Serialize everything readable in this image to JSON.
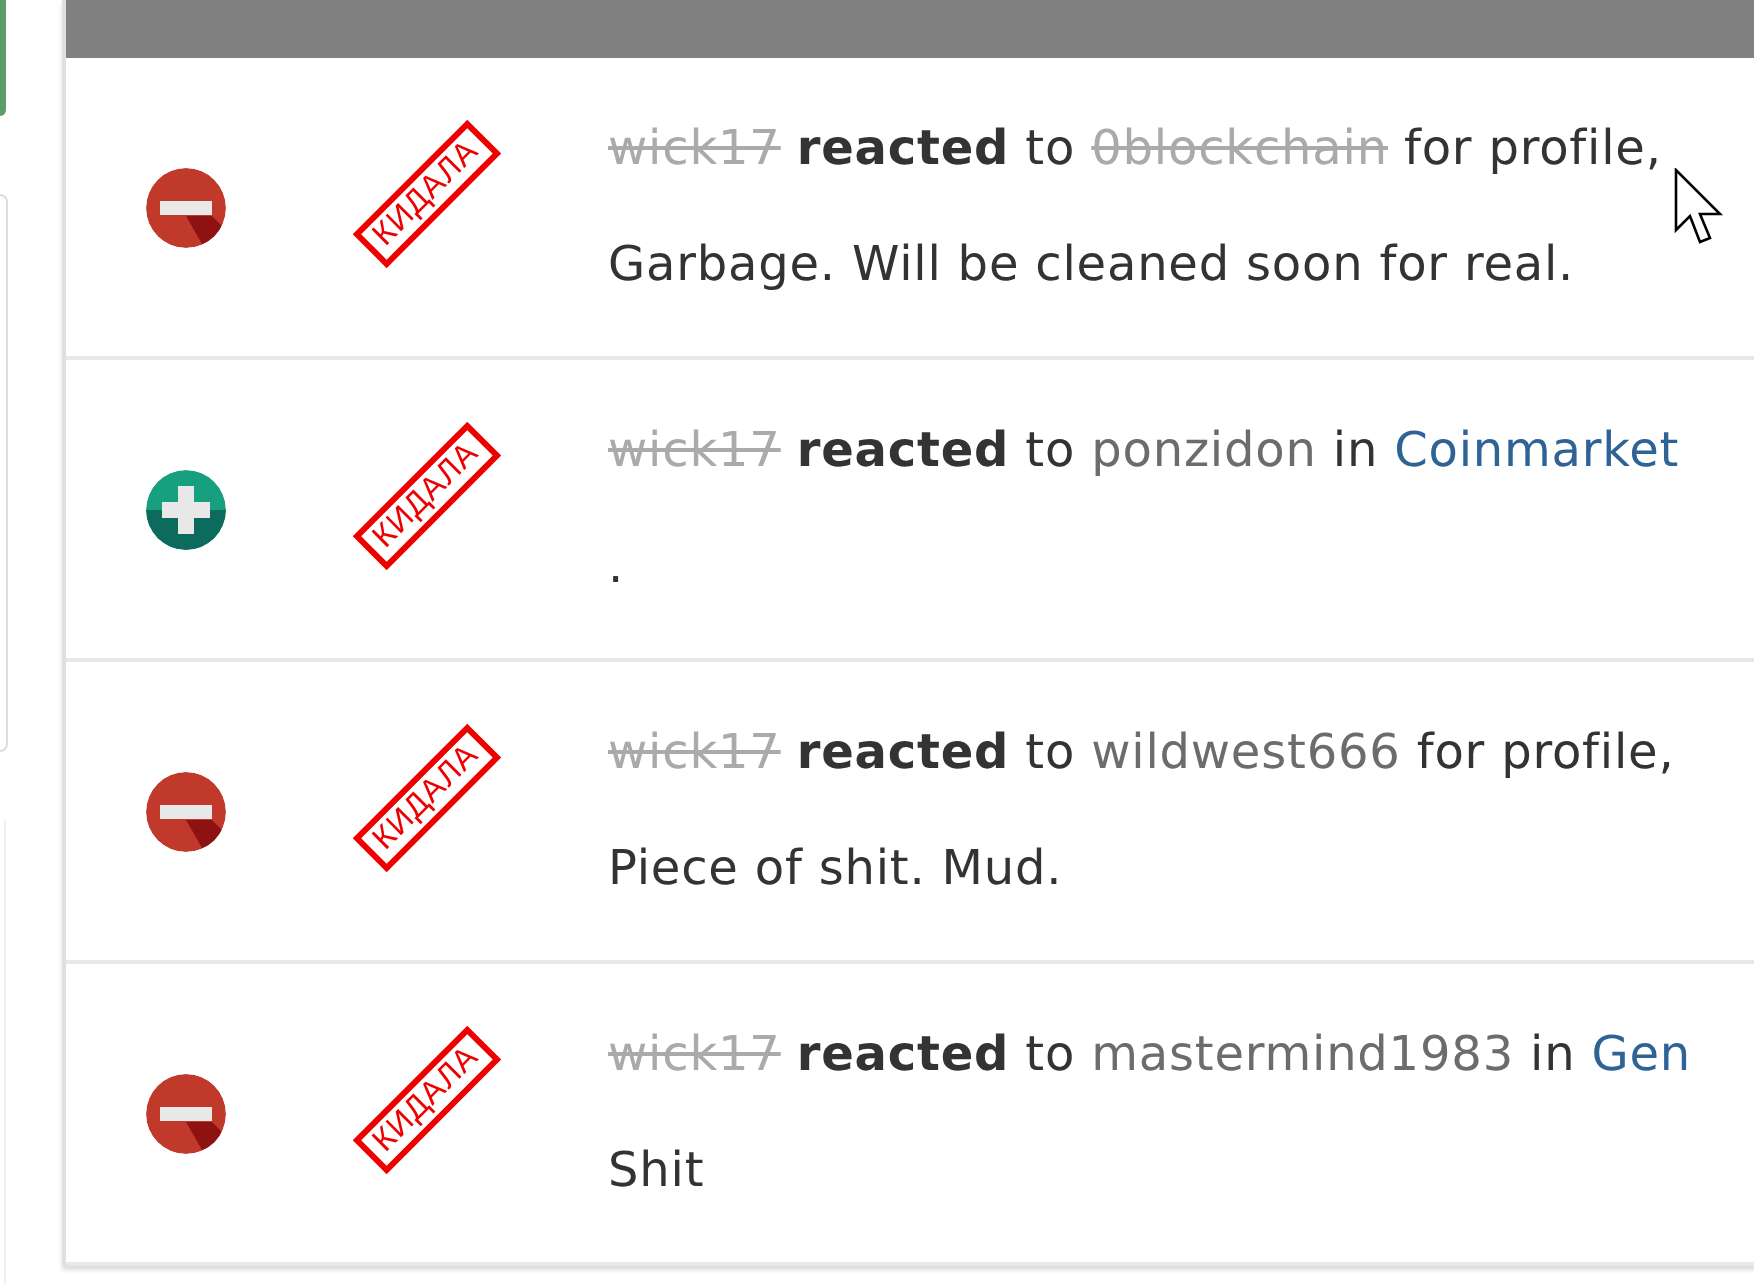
{
  "rows": [
    {
      "kind": "negative",
      "stamp": "КИДАЛА",
      "parts": [
        {
          "kind": "user",
          "text": "wick17",
          "struck": true
        },
        {
          "kind": "verb",
          "text": "reacted"
        },
        {
          "kind": "plain",
          "text": "to"
        },
        {
          "kind": "user",
          "text": "0blockchain",
          "struck": true
        },
        {
          "kind": "plain",
          "text": "for profile,"
        }
      ],
      "comment": "Garbage. Will be cleaned soon for real."
    },
    {
      "kind": "positive",
      "stamp": "КИДАЛА",
      "parts": [
        {
          "kind": "user",
          "text": "wick17",
          "struck": true
        },
        {
          "kind": "verb",
          "text": "reacted"
        },
        {
          "kind": "plain",
          "text": "to"
        },
        {
          "kind": "user",
          "text": "ponzidon",
          "struck": false
        },
        {
          "kind": "plain",
          "text": "in"
        },
        {
          "kind": "link",
          "text": "Coinmarket"
        }
      ],
      "comment": "."
    },
    {
      "kind": "negative",
      "stamp": "КИДАЛА",
      "parts": [
        {
          "kind": "user",
          "text": "wick17",
          "struck": true
        },
        {
          "kind": "verb",
          "text": "reacted"
        },
        {
          "kind": "plain",
          "text": "to"
        },
        {
          "kind": "user",
          "text": "wildwest666",
          "struck": false
        },
        {
          "kind": "plain",
          "text": "for profile,"
        }
      ],
      "comment": "Piece of shit. Mud."
    },
    {
      "kind": "negative",
      "stamp": "КИДАЛА",
      "parts": [
        {
          "kind": "user",
          "text": "wick17",
          "struck": true
        },
        {
          "kind": "verb",
          "text": "reacted"
        },
        {
          "kind": "plain",
          "text": "to"
        },
        {
          "kind": "user",
          "text": "mastermind1983",
          "struck": false
        },
        {
          "kind": "plain",
          "text": "in"
        },
        {
          "kind": "link",
          "text": "Gen"
        }
      ],
      "comment": "Shit"
    }
  ]
}
